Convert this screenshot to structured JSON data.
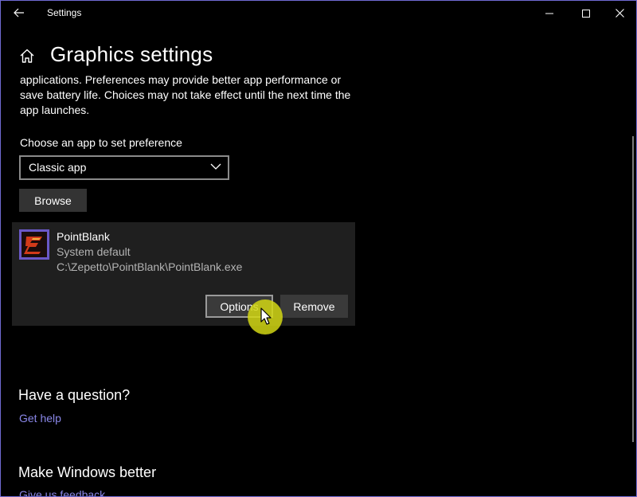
{
  "window": {
    "title": "Settings",
    "controls": {
      "minimize": "minimize-icon",
      "maximize": "maximize-icon",
      "close": "close-icon"
    }
  },
  "header": {
    "title": "Graphics settings",
    "home_icon": "home-icon"
  },
  "description": "applications. Preferences may provide better app performance or save battery life. Choices may not take effect until the next time the app launches.",
  "app_picker": {
    "label": "Choose an app to set preference",
    "selected": "Classic app",
    "browse_label": "Browse"
  },
  "app_entry": {
    "name": "PointBlank",
    "preference": "System default",
    "path": "C:\\Zepetto\\PointBlank\\PointBlank.exe",
    "options_label": "Options",
    "remove_label": "Remove"
  },
  "help": {
    "question_title": "Have a question?",
    "get_help_link": "Get help",
    "improve_title": "Make Windows better",
    "feedback_link": "Give us feedback"
  },
  "colors": {
    "background": "#000000",
    "accent_link": "#8a87e8",
    "card": "#1f1f1f",
    "cursor_highlight": "#d2d714"
  }
}
